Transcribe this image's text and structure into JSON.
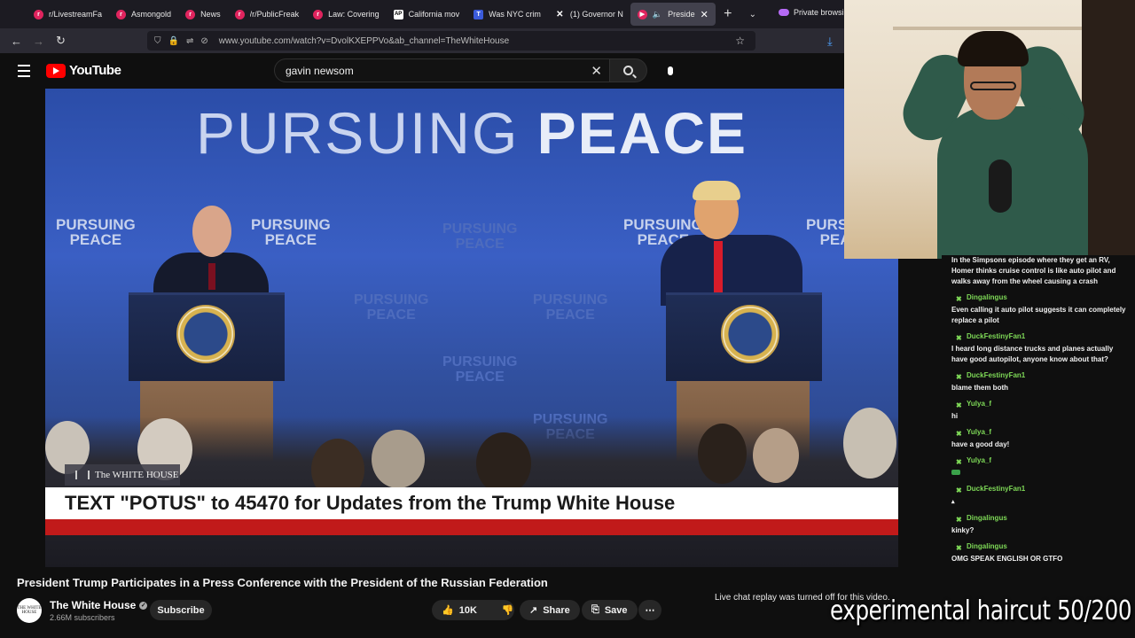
{
  "browser": {
    "tabs": [
      {
        "label": "r/LivestreamFa",
        "icon": "reddit-icon"
      },
      {
        "label": "Asmongold",
        "icon": "reddit-icon"
      },
      {
        "label": "News",
        "icon": "reddit-icon"
      },
      {
        "label": "/r/PublicFreak",
        "icon": "reddit-icon"
      },
      {
        "label": "Law: Covering",
        "icon": "reddit-icon"
      },
      {
        "label": "California mov",
        "icon": "ap-icon"
      },
      {
        "label": "Was NYC crim",
        "icon": "t-icon"
      },
      {
        "label": "(1) Governor N",
        "icon": "x-icon"
      },
      {
        "label": "Preside",
        "icon": "youtube-icon",
        "active": true
      }
    ],
    "private_label": "Private browsin",
    "url": "www.youtube.com/watch?v=DvolKXEPPVo&ab_channel=TheWhiteHouse"
  },
  "youtube": {
    "logo_text": "YouTube",
    "search_value": "gavin newsom"
  },
  "video": {
    "backdrop_title_light": "PURSUING ",
    "backdrop_title_bold": "PEACE",
    "banner_line1": "PURSUING",
    "banner_line2": "PEACE",
    "network_bug": "The WHITE HOUSE",
    "lower_third": "TEXT \"POTUS\" to 45470 for Updates from the Trump White House",
    "title": "President Trump Participates in a Press Conference with the President of the Russian Federation"
  },
  "channel": {
    "name": "The White House",
    "subscribers": "2.66M subscribers",
    "avatar_text": "THE WHITE HOUSE",
    "subscribe_label": "Subscribe"
  },
  "actions": {
    "likes": "10K",
    "share_label": "Share",
    "save_label": "Save"
  },
  "chat": {
    "replay_off_notice": "Live chat replay was turned off for this video.",
    "messages": [
      {
        "user": "",
        "text": "In the Simpsons episode where they get an RV, Homer thinks cruise control is like auto pilot and walks away from the wheel causing a crash"
      },
      {
        "user": "Dingalingus",
        "text": "Even calling it auto pilot suggests it can completely replace a pilot"
      },
      {
        "user": "DuckFestinyFan1",
        "text": "I heard long distance trucks and planes actually have good autopilot, anyone know about that?"
      },
      {
        "user": "DuckFestinyFan1",
        "text": "blame them both"
      },
      {
        "user": "Yulya_f",
        "text": "hi"
      },
      {
        "user": "Yulya_f",
        "text": "have a good day!"
      },
      {
        "user": "Yulya_f",
        "text": ""
      },
      {
        "user": "DuckFestinyFan1",
        "text": ""
      },
      {
        "user": "Dingalingus",
        "text": "kinky?"
      },
      {
        "user": "Dingalingus",
        "text": "OMG SPEAK ENGLISH OR GTFO"
      }
    ]
  },
  "stream_overlay": {
    "caption": "experimental haircut 50/200"
  },
  "colors": {
    "youtube_red": "#ff0000",
    "chat_username": "#7ed957",
    "lower_third_red": "#c11a1a"
  }
}
